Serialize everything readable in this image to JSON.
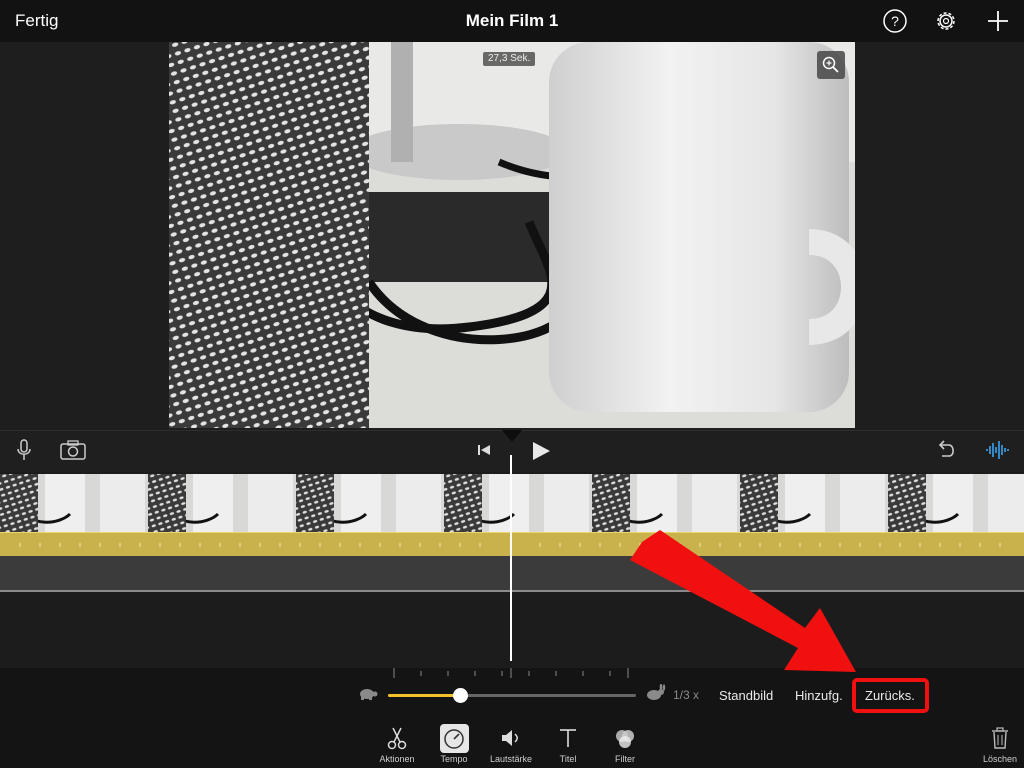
{
  "header": {
    "done_label": "Fertig",
    "title": "Mein Film 1",
    "icons": [
      "help-icon",
      "settings-icon",
      "add-icon"
    ]
  },
  "viewer": {
    "duration_badge": "27,3 Sek.",
    "zoom_icon": "zoom-in-icon"
  },
  "controls": {
    "icons": [
      "microphone-icon",
      "camera-icon",
      "skip-to-start-icon",
      "play-icon",
      "undo-icon",
      "audio-waveform-icon"
    ]
  },
  "speed": {
    "value_label": "1/3 x",
    "level_fraction": 0.29,
    "slow_icon": "turtle-icon",
    "fast_icon": "rabbit-icon",
    "accent_color": "#f4c02c"
  },
  "actions": {
    "freeze_label": "Standbild",
    "add_label": "Hinzufg.",
    "reset_label": "Zurücks."
  },
  "toolbar": {
    "items": [
      {
        "label": "Aktionen",
        "icon": "scissors-icon"
      },
      {
        "label": "Tempo",
        "icon": "speedometer-icon",
        "selected": true
      },
      {
        "label": "Lautstärke",
        "icon": "speaker-icon"
      },
      {
        "label": "Titel",
        "icon": "title-t-icon"
      },
      {
        "label": "Filter",
        "icon": "filter-circles-icon"
      }
    ],
    "delete_label": "Löschen"
  },
  "annotation": {
    "highlight_color": "#f01010"
  }
}
